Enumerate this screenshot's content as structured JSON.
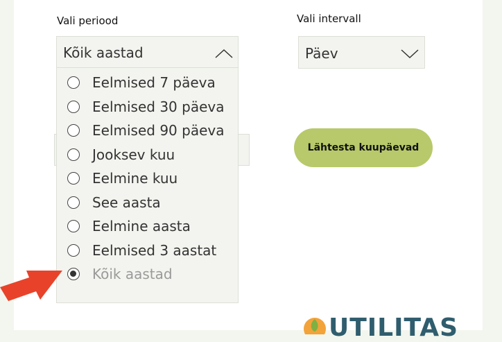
{
  "period": {
    "label": "Vali periood",
    "selected": "Kõik aastad",
    "options": [
      {
        "label": "Eelmised 7 päeva",
        "selected": false
      },
      {
        "label": "Eelmised 30 päeva",
        "selected": false
      },
      {
        "label": "Eelmised 90 päeva",
        "selected": false
      },
      {
        "label": "Jooksev kuu",
        "selected": false
      },
      {
        "label": "Eelmine kuu",
        "selected": false
      },
      {
        "label": "See aasta",
        "selected": false
      },
      {
        "label": "Eelmine aasta",
        "selected": false
      },
      {
        "label": "Eelmised 3 aastat",
        "selected": false
      },
      {
        "label": "Kõik aastad",
        "selected": true
      }
    ]
  },
  "interval": {
    "label": "Vali intervall",
    "selected": "Päev"
  },
  "reset_button": {
    "label": "Lähtesta kuupäevad"
  },
  "logo": {
    "text": "UTILITAS"
  },
  "colors": {
    "accent_button": "#b7c96a",
    "annotation_arrow": "#e8432a",
    "field_bg": "#f3f4ef"
  }
}
